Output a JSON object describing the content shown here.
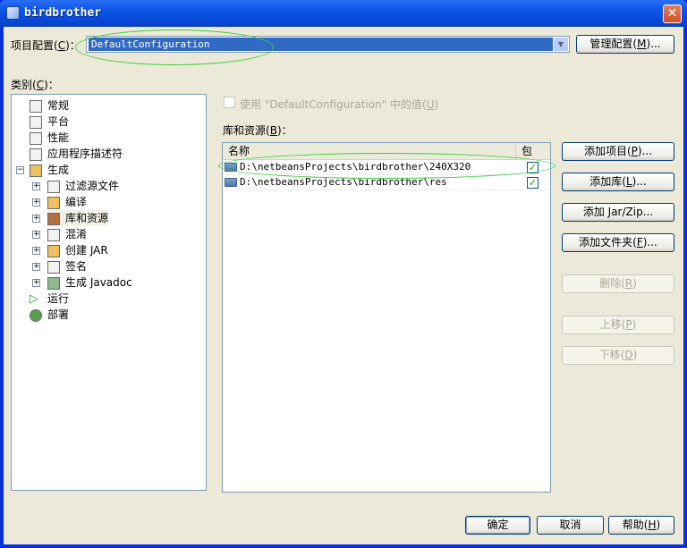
{
  "window": {
    "title": "birdbrother",
    "close": "✕"
  },
  "config": {
    "label": "项目配置",
    "mnemonic": "C",
    "selected": "DefaultConfiguration",
    "manage_button": "管理配置",
    "manage_mnemonic": "M"
  },
  "category": {
    "label": "类别",
    "mnemonic": "C"
  },
  "tree": [
    {
      "label": "常规"
    },
    {
      "label": "平台"
    },
    {
      "label": "性能"
    },
    {
      "label": "应用程序描述符"
    },
    {
      "label": "生成"
    },
    {
      "label": "过滤源文件"
    },
    {
      "label": "编译"
    },
    {
      "label": "库和资源"
    },
    {
      "label": "混淆"
    },
    {
      "label": "创建 JAR"
    },
    {
      "label": "签名"
    },
    {
      "label": "生成 Javadoc"
    },
    {
      "label": "运行"
    },
    {
      "label": "部署"
    }
  ],
  "use_default": {
    "label": "使用 \"DefaultConfiguration\" 中的值",
    "mnemonic": "U",
    "checked": false
  },
  "libraries": {
    "label": "库和资源",
    "mnemonic": "B",
    "columns": [
      "名称",
      "包"
    ],
    "rows": [
      {
        "path": "D:\\netbeansProjects\\birdbrother\\240X320",
        "checked": "✓"
      },
      {
        "path": "D:\\netbeansProjects\\birdbrother\\res",
        "checked": "✓"
      }
    ]
  },
  "side_buttons": {
    "add_project": "添加项目",
    "add_project_m": "P",
    "add_library": "添加库",
    "add_library_m": "L",
    "add_jar": "添加 Jar/Zip...",
    "add_folder": "添加文件夹",
    "add_folder_m": "F",
    "remove": "删除",
    "remove_m": "R",
    "move_up": "上移",
    "move_up_m": "P",
    "move_down": "下移",
    "move_down_m": "D"
  },
  "footer": {
    "ok": "确定",
    "cancel": "取消",
    "help": "帮助",
    "help_m": "H"
  },
  "colors": {
    "selection": "#316ac5",
    "annotation": "#3ad13a",
    "dialog_bg": "#ece9d8"
  }
}
